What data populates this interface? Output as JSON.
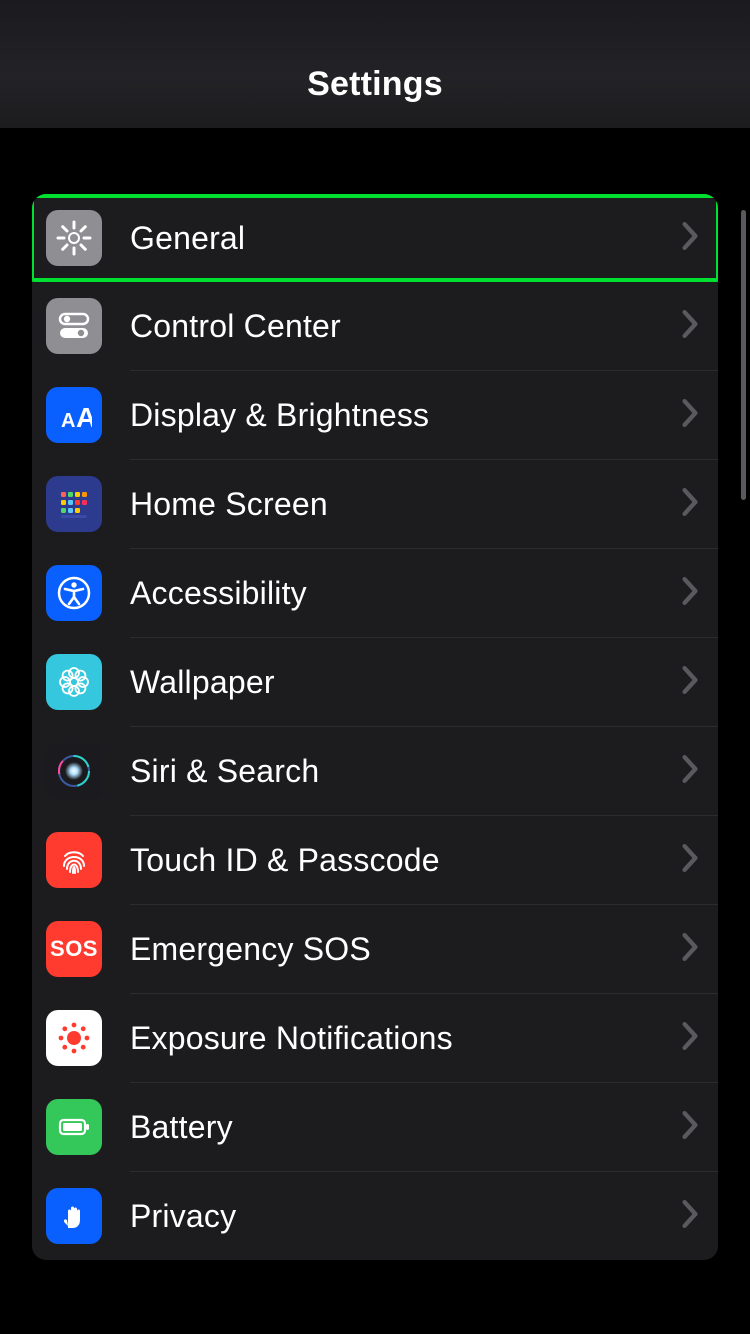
{
  "header": {
    "title": "Settings"
  },
  "rows": [
    {
      "id": "general",
      "label": "General",
      "icon": "gear-icon",
      "bg": "#8e8e93",
      "highlighted": true
    },
    {
      "id": "control-center",
      "label": "Control Center",
      "icon": "toggles-icon",
      "bg": "#8e8e93"
    },
    {
      "id": "display-brightness",
      "label": "Display & Brightness",
      "icon": "text-size-icon",
      "bg": "#0a60ff"
    },
    {
      "id": "home-screen",
      "label": "Home Screen",
      "icon": "grid-icon",
      "bg": "#2d3b8f"
    },
    {
      "id": "accessibility",
      "label": "Accessibility",
      "icon": "accessibility-icon",
      "bg": "#0a60ff"
    },
    {
      "id": "wallpaper",
      "label": "Wallpaper",
      "icon": "flower-icon",
      "bg": "#35c7de"
    },
    {
      "id": "siri-search",
      "label": "Siri & Search",
      "icon": "siri-icon",
      "bg": "#1b1b1f"
    },
    {
      "id": "touch-id",
      "label": "Touch ID & Passcode",
      "icon": "fingerprint-icon",
      "bg": "#ff3b30"
    },
    {
      "id": "emergency-sos",
      "label": "Emergency SOS",
      "icon": "sos-icon",
      "bg": "#ff3b30",
      "text_icon": "SOS"
    },
    {
      "id": "exposure-notifications",
      "label": "Exposure Notifications",
      "icon": "exposure-icon",
      "bg": "#ffffff"
    },
    {
      "id": "battery",
      "label": "Battery",
      "icon": "battery-icon",
      "bg": "#34c759"
    },
    {
      "id": "privacy",
      "label": "Privacy",
      "icon": "hand-icon",
      "bg": "#0a60ff"
    }
  ]
}
